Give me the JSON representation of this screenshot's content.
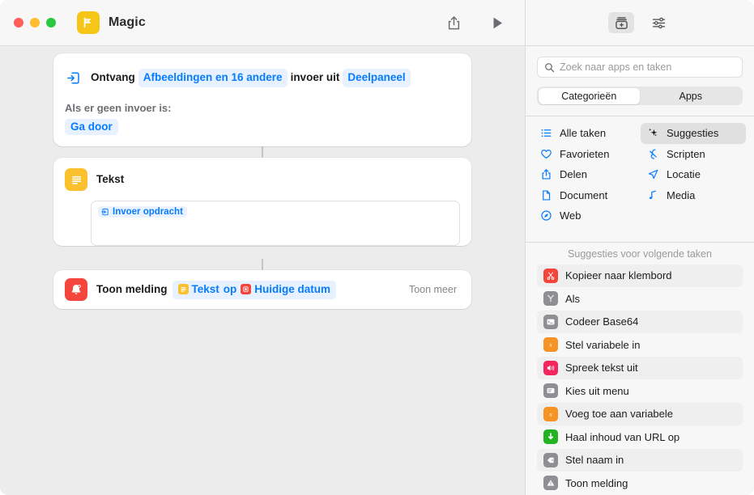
{
  "window": {
    "title": "Magic",
    "app_icon": "shortcut-magic-icon"
  },
  "toolbar": {
    "share_icon": "share-icon",
    "run_icon": "play-icon",
    "library_icon": "action-library-icon",
    "settings_icon": "sliders-icon"
  },
  "workflow": {
    "actions": [
      {
        "icon": "receive-input-icon",
        "prefix": "Ontvang",
        "token_input": "Afbeeldingen en 16 andere",
        "middle": "invoer uit",
        "token_source": "Deelpaneel",
        "no_input_label": "Als er geen invoer is:",
        "no_input_value": "Ga door"
      },
      {
        "icon": "text-icon",
        "title": "Tekst",
        "field_token": "Invoer opdracht"
      },
      {
        "icon": "notification-icon",
        "title": "Toon melding",
        "token_text": "Tekst",
        "joiner": "op",
        "token_date": "Huidige datum",
        "show_more": "Toon meer"
      }
    ]
  },
  "sidebar": {
    "search": {
      "placeholder": "Zoek naar apps en taken",
      "icon": "search-icon",
      "value": ""
    },
    "segments": [
      {
        "label": "Categorieën",
        "selected": true
      },
      {
        "label": "Apps",
        "selected": false
      }
    ],
    "categories": [
      {
        "label": "Alle taken",
        "icon": "list-bullet-icon",
        "selected": false
      },
      {
        "label": "Suggesties",
        "icon": "sparkles-icon",
        "selected": true
      },
      {
        "label": "Favorieten",
        "icon": "heart-icon",
        "selected": false
      },
      {
        "label": "Scripten",
        "icon": "script-icon",
        "selected": false
      },
      {
        "label": "Delen",
        "icon": "share-icon",
        "selected": false
      },
      {
        "label": "Locatie",
        "icon": "location-icon",
        "selected": false
      },
      {
        "label": "Document",
        "icon": "document-icon",
        "selected": false
      },
      {
        "label": "Media",
        "icon": "music-note-icon",
        "selected": false
      },
      {
        "label": "Web",
        "icon": "safari-icon",
        "selected": false
      }
    ],
    "suggestions_header": "Suggesties voor volgende taken",
    "suggestions": [
      {
        "label": "Kopieer naar klembord",
        "icon": "scissors-icon",
        "color": "si-red"
      },
      {
        "label": "Als",
        "icon": "branch-icon",
        "color": "si-gray"
      },
      {
        "label": "Codeer Base64",
        "icon": "terminal-icon",
        "color": "si-gray"
      },
      {
        "label": "Stel variabele in",
        "icon": "variable-x-icon",
        "color": "si-orange"
      },
      {
        "label": "Spreek tekst uit",
        "icon": "speaker-icon",
        "color": "si-pink"
      },
      {
        "label": "Kies uit menu",
        "icon": "menu-icon",
        "color": "si-gray"
      },
      {
        "label": "Voeg toe aan variabele",
        "icon": "variable-x-icon",
        "color": "si-orange"
      },
      {
        "label": "Haal inhoud van URL op",
        "icon": "download-icon",
        "color": "si-green"
      },
      {
        "label": "Stel naam in",
        "icon": "tag-icon",
        "color": "si-gray"
      },
      {
        "label": "Toon melding",
        "icon": "alert-icon",
        "color": "si-gray"
      }
    ]
  },
  "colors": {
    "accent_blue": "#067cff",
    "token_bg": "#e8f1ff",
    "canvas_bg": "#ececec",
    "chrome_bg": "#f7f7f7"
  }
}
